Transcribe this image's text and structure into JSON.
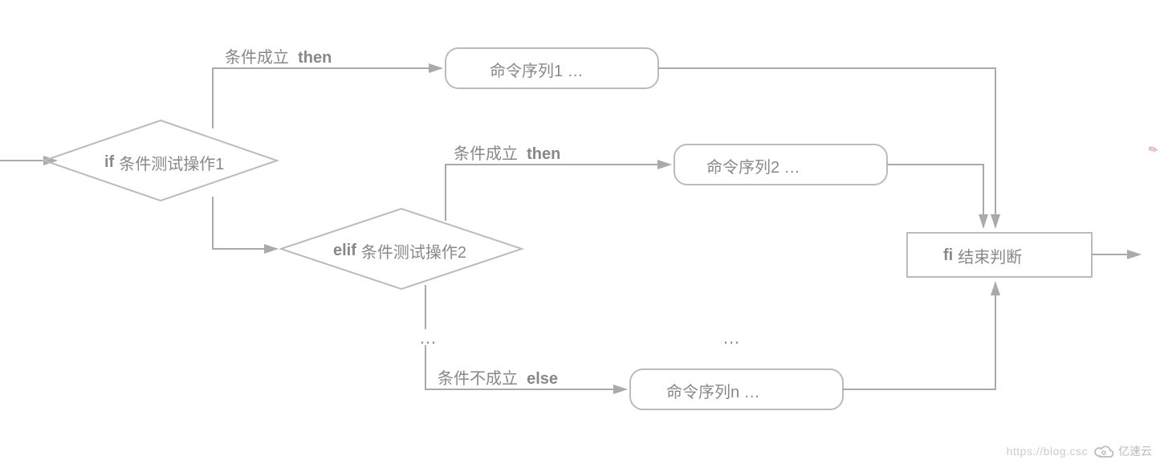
{
  "diagram": {
    "type": "flowchart",
    "description": "Shell if/elif/else/fi multi-branch conditional flow",
    "nodes": {
      "if_decision": {
        "keyword": "if",
        "text": "条件测试操作1"
      },
      "cmd1": {
        "text": "命令序列1 …"
      },
      "elif_decision": {
        "keyword": "elif",
        "text": "条件测试操作2"
      },
      "cmd2": {
        "text": "命令序列2 …"
      },
      "ellipsis_branch": {
        "text": "…"
      },
      "ellipsis_cmd": {
        "text": "…"
      },
      "cmdn": {
        "text": "命令序列n …"
      },
      "fi": {
        "keyword": "fi",
        "text": "结束判断"
      }
    },
    "edges": {
      "if_true": {
        "label_text": "条件成立",
        "label_kw": "then",
        "from": "if_decision",
        "to": "cmd1"
      },
      "elif_true": {
        "label_text": "条件成立",
        "label_kw": "then",
        "from": "elif_decision",
        "to": "cmd2"
      },
      "else": {
        "label_text": "条件不成立",
        "label_kw": "else",
        "from": "ellipsis_branch",
        "to": "cmdn"
      }
    }
  },
  "footer": {
    "watermark": "https://blog.csc",
    "logo_text": "亿速云"
  }
}
